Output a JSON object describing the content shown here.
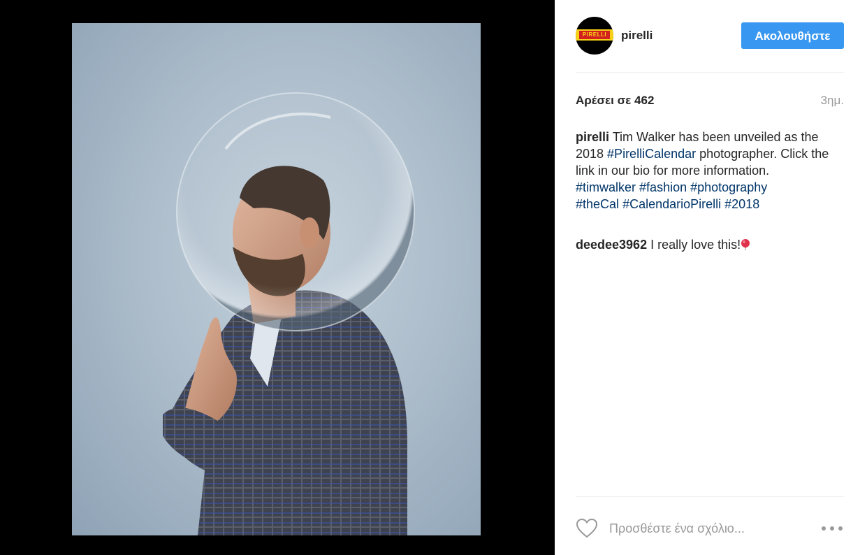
{
  "post": {
    "username": "pirelli",
    "avatar_brand": "PIRELLI",
    "follow_label": "Ακολουθήστε",
    "likes": "Αρέσει σε 462",
    "time": "3ημ."
  },
  "caption": {
    "user": "pirelli",
    "text_part1": " Tim Walker has been unveiled as the 2018 ",
    "tag1": "#PirelliCalendar",
    "text_part2": " photographer. Click the link in our bio for more information.",
    "tags": [
      "#timwalker",
      "#fashion",
      "#photography",
      "#theCal",
      "#CalendarioPirelli",
      "#2018"
    ]
  },
  "comments": [
    {
      "user": "deedee3962",
      "text": " I really love this!"
    }
  ],
  "footer": {
    "placeholder": "Προσθέστε ένα σχόλιο..."
  },
  "colors": {
    "accent": "#3897f0",
    "hashtag": "#003569",
    "brand_yellow": "#f7d117",
    "brand_red": "#d3211f"
  },
  "icons": [
    "heart-icon",
    "more-options-icon",
    "balloon-emoji-icon"
  ]
}
